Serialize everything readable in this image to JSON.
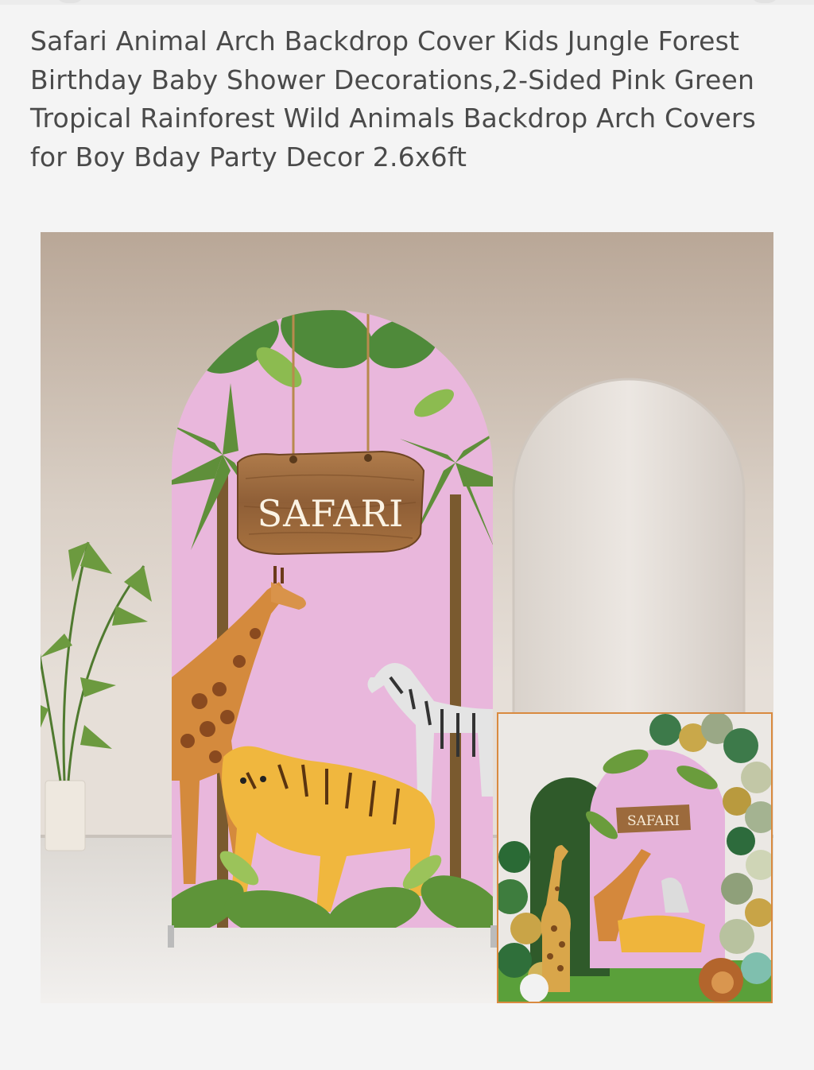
{
  "product": {
    "title": "Safari Animal Arch Backdrop Cover Kids Jungle Forest Birthday Baby Shower Decorations,2-Sided Pink Green Tropical Rainforest Wild Animals Backdrop Arch Covers for Boy Bday Party Decor 2.6x6ft"
  },
  "image": {
    "sign_text": "SAFARI",
    "inset_sign_text": "SAFARI"
  },
  "colors": {
    "backdrop_pink": "#e9b7dc",
    "wood": "#9b6a3f",
    "inset_border": "#d98a3f",
    "leaf_green": "#5f8f3a"
  }
}
